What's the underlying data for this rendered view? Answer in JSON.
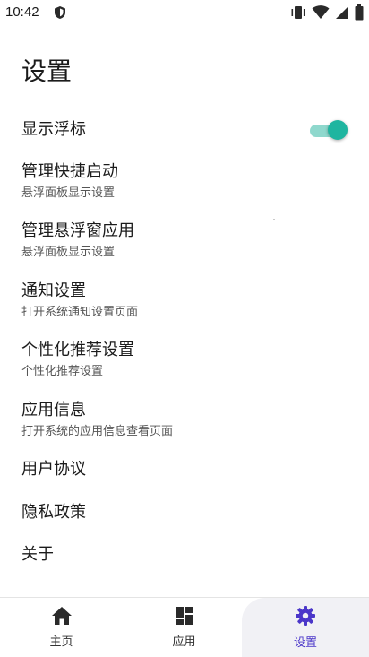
{
  "status": {
    "time": "10:42",
    "icons": [
      "shield-icon",
      "vibrate-icon",
      "wifi-icon",
      "signal-icon",
      "battery-icon"
    ]
  },
  "page": {
    "title": "设置"
  },
  "settings": {
    "float_toggle": {
      "label": "显示浮标",
      "on": true
    },
    "items": [
      {
        "title": "管理快捷启动",
        "subtitle": "悬浮面板显示设置"
      },
      {
        "title": "管理悬浮窗应用",
        "subtitle": "悬浮面板显示设置"
      },
      {
        "title": "通知设置",
        "subtitle": "打开系统通知设置页面"
      },
      {
        "title": "个性化推荐设置",
        "subtitle": "个性化推荐设置"
      },
      {
        "title": "应用信息",
        "subtitle": "打开系统的应用信息查看页面"
      },
      {
        "title": "用户协议"
      },
      {
        "title": "隐私政策"
      },
      {
        "title": "关于"
      }
    ]
  },
  "nav": {
    "home": "主页",
    "apps": "应用",
    "settings": "设置",
    "active": "settings",
    "colors": {
      "active": "#4b37c9",
      "inactive": "#333333"
    }
  },
  "colors": {
    "accent": "#1fb5a0",
    "accent_track": "#8fd8cd"
  }
}
